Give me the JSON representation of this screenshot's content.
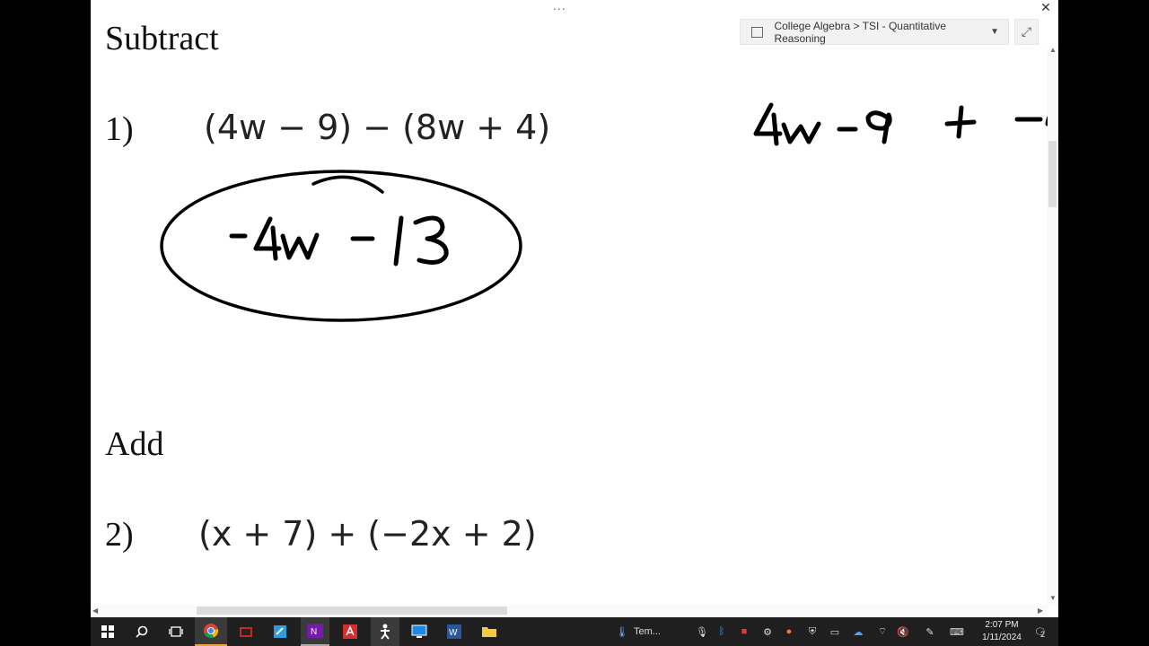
{
  "window": {
    "more_dots": "...",
    "close_glyph": "✕",
    "breadcrumb": "College Algebra > TSI - Quantitative Reasoning",
    "expand_glyph": "⤢"
  },
  "page": {
    "subtract_heading": "Subtract",
    "problem1_number": "1)",
    "problem1_expr": "(4w − 9) − (8w + 4)",
    "add_heading": "Add",
    "problem2_number": "2)",
    "problem2_expr": "(x + 7) + (−2x + 2)"
  },
  "ink": {
    "answer": "-4w-13",
    "work": "4w-9 + -"
  },
  "taskbar": {
    "apps": [
      "windows-start",
      "search",
      "task-view",
      "chrome",
      "media-app",
      "notepad",
      "onenote",
      "acrobat",
      "app-figure",
      "remote-desktop",
      "word",
      "file-explorer"
    ],
    "weather_label": "Tem...",
    "time": "2:07 PM",
    "date": "1/11/2024",
    "notification_count": "2"
  }
}
